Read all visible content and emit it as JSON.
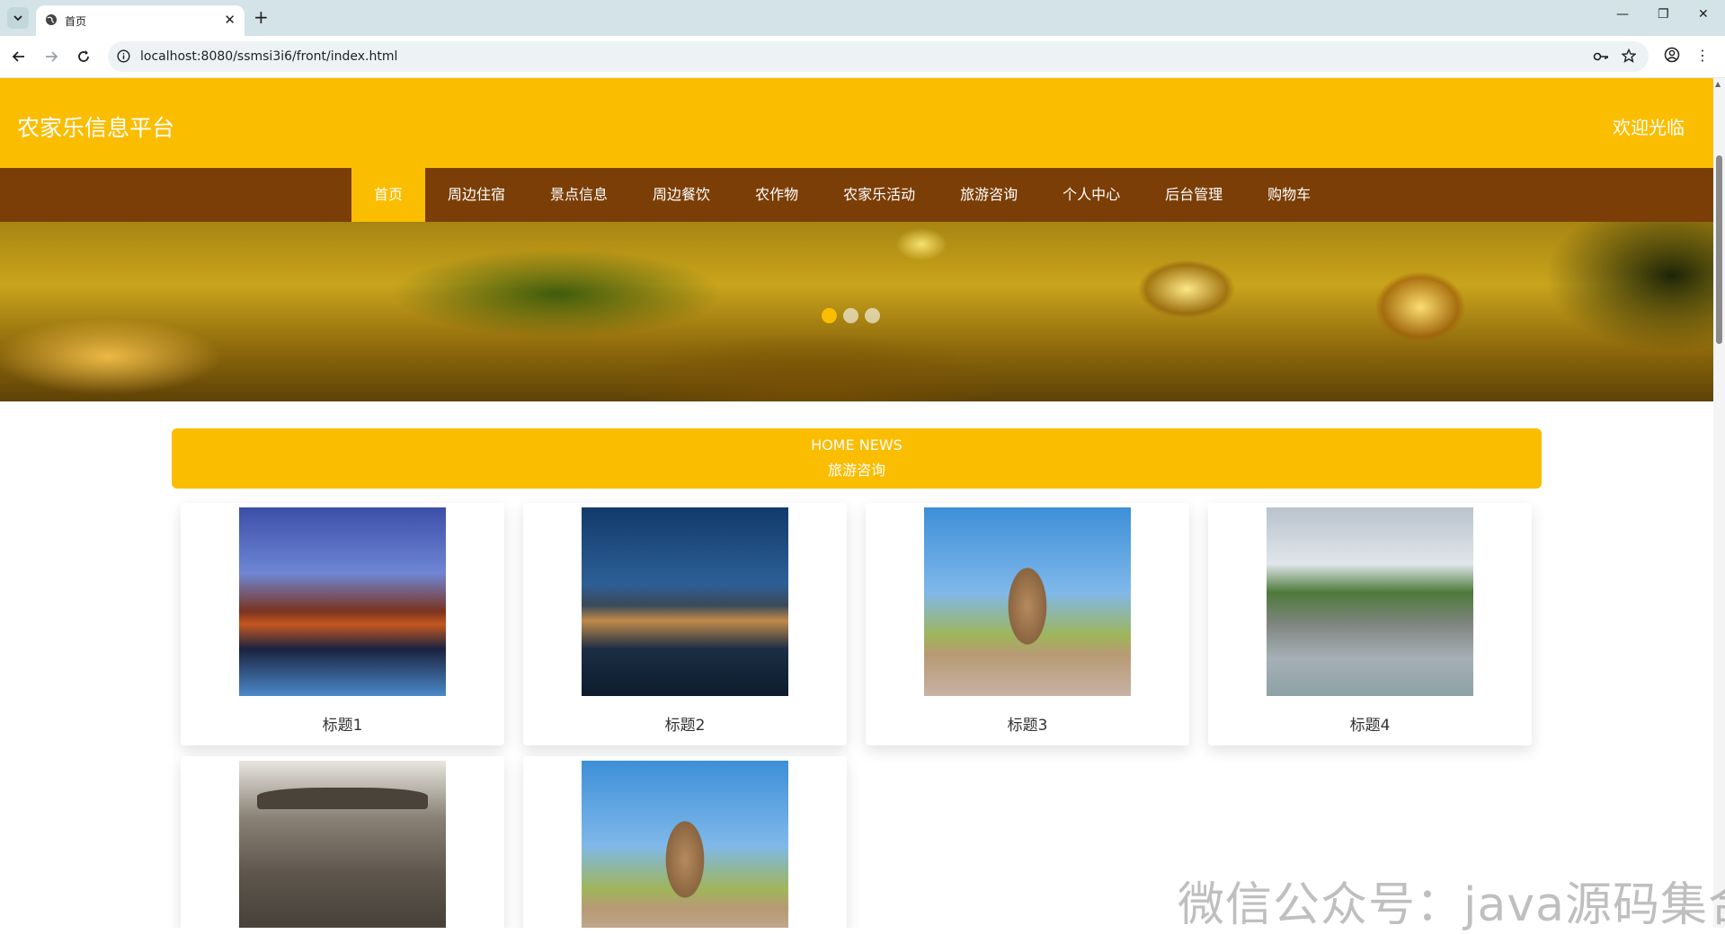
{
  "browser": {
    "tab_title": "首页",
    "url": "localhost:8080/ssmsi3i6/front/index.html",
    "icons": [
      "tab-list-icon",
      "globe-icon",
      "close-icon",
      "new-tab-icon",
      "minimize-icon",
      "restore-icon",
      "window-close-icon",
      "back-icon",
      "forward-icon",
      "reload-icon",
      "site-info-icon",
      "password-key-icon",
      "bookmark-star-icon",
      "profile-icon",
      "menu-icon"
    ]
  },
  "header": {
    "site_title": "农家乐信息平台",
    "welcome": "欢迎光临",
    "bg_color": "#fbbd00"
  },
  "nav": {
    "bg_color": "#7b3e06",
    "active_color": "#fbbd00",
    "items": [
      {
        "label": "首页",
        "active": true
      },
      {
        "label": "周边住宿"
      },
      {
        "label": "景点信息"
      },
      {
        "label": "周边餐饮"
      },
      {
        "label": "农作物"
      },
      {
        "label": "农家乐活动"
      },
      {
        "label": "旅游咨询"
      },
      {
        "label": "个人中心"
      },
      {
        "label": "后台管理"
      },
      {
        "label": "购物车"
      }
    ]
  },
  "banner": {
    "slide_count": 3,
    "active_slide": 1
  },
  "news": {
    "heading_en": "HOME NEWS",
    "heading_cn": "旅游咨询",
    "cards": [
      {
        "title": "标题1",
        "image": "night-water-town"
      },
      {
        "title": "标题2",
        "image": "lake-village"
      },
      {
        "title": "标题3",
        "image": "buddha-statue"
      },
      {
        "title": "标题4",
        "image": "elephant-trunk-hill"
      },
      {
        "title": "",
        "image": "stone-archway"
      },
      {
        "title": "",
        "image": "buddha-statue"
      }
    ]
  },
  "watermark": "微信公众号：java源码集合"
}
